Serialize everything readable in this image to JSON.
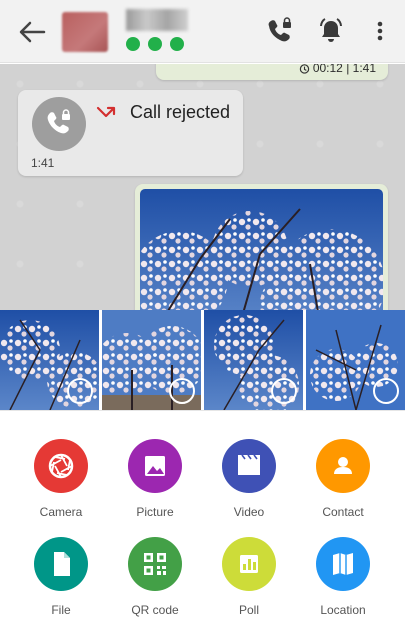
{
  "header": {
    "back_icon": "arrow-left-icon",
    "actions": [
      "phone-lock-icon",
      "bell-alert-icon",
      "more-vert-icon"
    ],
    "status_dot_color": "#22b04a"
  },
  "chat": {
    "top_bubble_time": "00:12 | 1:41",
    "call": {
      "text": "Call rejected",
      "time": "1:41",
      "arrow_color": "#d32f2f"
    }
  },
  "gallery": {
    "count": 4
  },
  "attach_options": [
    {
      "label": "Camera",
      "color": "#e53935",
      "icon": "camera-aperture-icon"
    },
    {
      "label": "Picture",
      "color": "#9c27b0",
      "icon": "image-icon"
    },
    {
      "label": "Video",
      "color": "#3f51b5",
      "icon": "video-clapper-icon"
    },
    {
      "label": "Contact",
      "color": "#ff9800",
      "icon": "contact-person-icon"
    },
    {
      "label": "File",
      "color": "#009688",
      "icon": "file-icon"
    },
    {
      "label": "QR code",
      "color": "#43a047",
      "icon": "qr-code-icon"
    },
    {
      "label": "Poll",
      "color": "#cddc39",
      "icon": "poll-chart-icon"
    },
    {
      "label": "Location",
      "color": "#2196f3",
      "icon": "map-icon"
    }
  ]
}
